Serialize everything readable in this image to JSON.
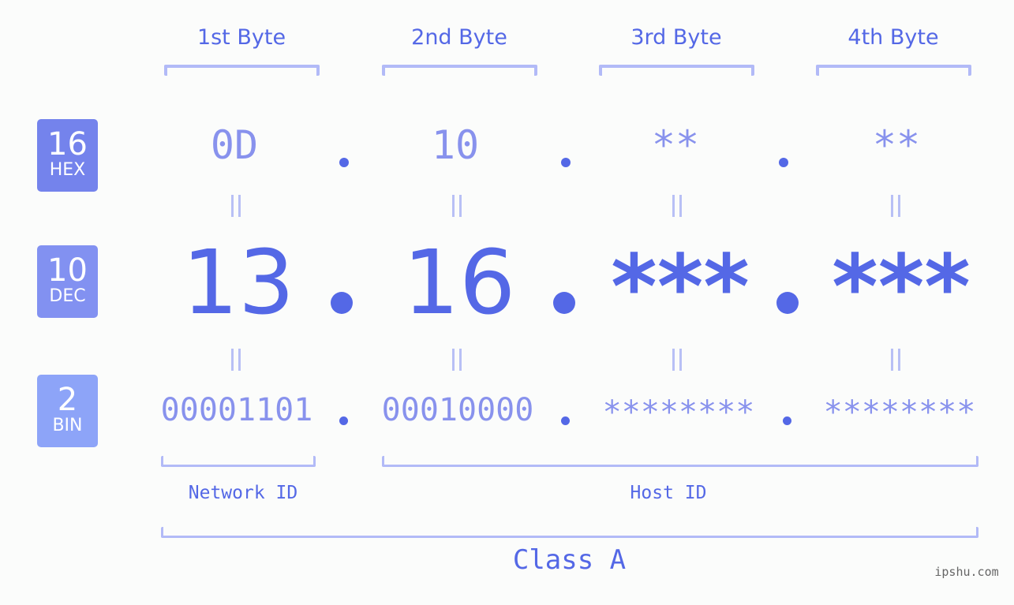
{
  "colors": {
    "accent": "#5468e6",
    "muted_value": "#8892ed",
    "bracket": "#b2baf7",
    "hex_badge": "#7483ec",
    "dec_badge": "#8291f1",
    "bin_badge": "#8da4f8",
    "background": "#fbfcfb"
  },
  "bytes": [
    {
      "header": "1st Byte",
      "hex": "0D",
      "dec": "13",
      "bin": "00001101"
    },
    {
      "header": "2nd Byte",
      "hex": "10",
      "dec": "16",
      "bin": "00010000"
    },
    {
      "header": "3rd Byte",
      "hex": "**",
      "dec": "***",
      "bin": "********"
    },
    {
      "header": "4th Byte",
      "hex": "**",
      "dec": "***",
      "bin": "********"
    }
  ],
  "badges": {
    "hex": {
      "number": "16",
      "label": "HEX"
    },
    "dec": {
      "number": "10",
      "label": "DEC"
    },
    "bin": {
      "number": "2",
      "label": "BIN"
    }
  },
  "segments": {
    "network": "Network ID",
    "host": "Host ID"
  },
  "class_label": "Class A",
  "watermark": "ipshu.com"
}
